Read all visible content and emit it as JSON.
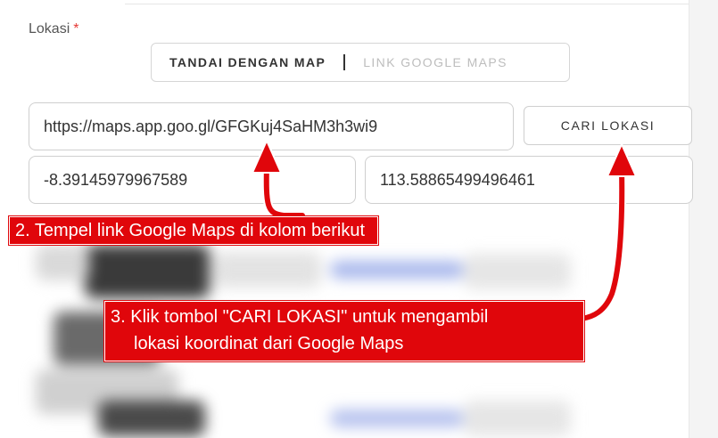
{
  "form": {
    "label": "Lokasi",
    "required_mark": "*",
    "toggle": {
      "options": [
        "TANDAI DENGAN MAP",
        "LINK GOOGLE MAPS"
      ],
      "active_index": 0
    },
    "url_input": {
      "value": "https://maps.app.goo.gl/GFGKuj4SaHM3h3wi9"
    },
    "search_button": "CARI LOKASI",
    "latitude": {
      "value": "-8.39145979967589"
    },
    "longitude": {
      "value": "113.58865499496461"
    }
  },
  "annotations": {
    "step2": "2. Tempel link Google Maps di kolom berikut",
    "step3_line1": "3. Klik tombol \"CARI LOKASI\" untuk mengambil",
    "step3_line2": "lokasi koordinat dari Google Maps"
  },
  "colors": {
    "annotation_red": "#e0060b",
    "border": "#cfcfcf",
    "required": "#e53935"
  }
}
